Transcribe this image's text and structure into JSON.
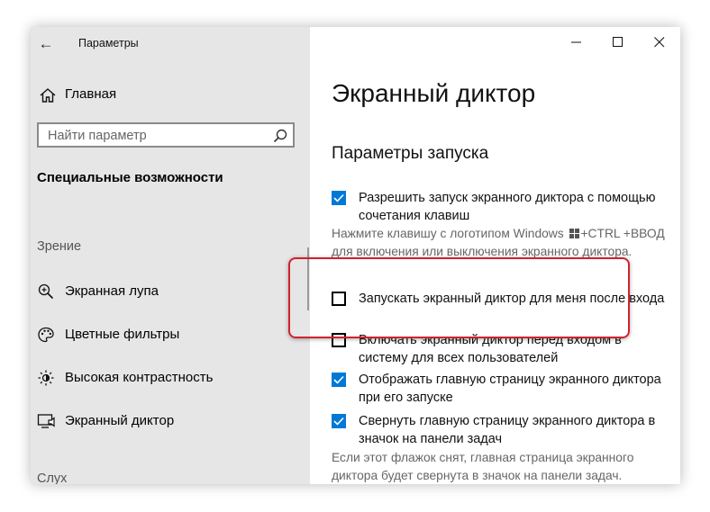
{
  "window": {
    "title": "Параметры"
  },
  "sidebar": {
    "home_label": "Главная",
    "search_placeholder": "Найти параметр",
    "section_title": "Специальные возможности",
    "group_vision": "Зрение",
    "items": [
      {
        "label": "Экранная лупа",
        "icon": "magnifier-icon"
      },
      {
        "label": "Цветные фильтры",
        "icon": "palette-icon"
      },
      {
        "label": "Высокая контрастность",
        "icon": "contrast-icon"
      },
      {
        "label": "Экранный диктор",
        "icon": "narrator-icon"
      }
    ],
    "group_hearing": "Слух"
  },
  "main": {
    "title": "Экранный диктор",
    "subtitle": "Параметры запуска",
    "shortcut_option": {
      "label": "Разрешить запуск экранного диктора с помощью сочетания клавиш",
      "checked": true
    },
    "shortcut_desc_before": "Нажмите клавишу с логотипом Windows",
    "shortcut_desc_after": "+CTRL +ВВОД для включения или выключения экранного диктора.",
    "options": [
      {
        "label": "Запускать экранный диктор для меня после входа",
        "checked": false
      },
      {
        "label": "Включать экранный диктор перед входом в систему для всех пользователей",
        "checked": false
      },
      {
        "label": "Отображать главную страницу экранного диктора при его запуске",
        "checked": true
      },
      {
        "label": "Свернуть главную страницу экранного диктора в значок на панели задач",
        "checked": true
      }
    ],
    "minimize_desc": "Если этот флажок снят, главная страница экранного диктора будет свернута в значок на панели задач."
  },
  "colors": {
    "accent": "#0078d7",
    "highlight": "#d0232e",
    "sidebar_bg": "#e6e6e6"
  }
}
